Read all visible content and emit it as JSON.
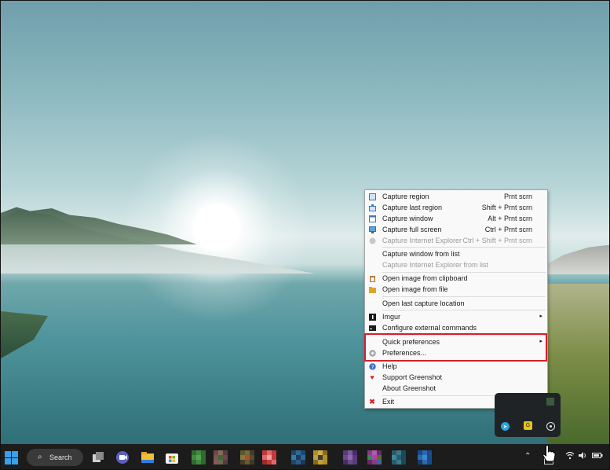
{
  "menu": {
    "items": [
      {
        "label": "Capture region",
        "shortcut": "Prnt scrn",
        "icon": "capture-region-icon",
        "disabled": false
      },
      {
        "label": "Capture last region",
        "shortcut": "Shift + Prnt scrn",
        "icon": "capture-last-region-icon",
        "disabled": false
      },
      {
        "label": "Capture window",
        "shortcut": "Alt + Prnt scrn",
        "icon": "capture-window-icon",
        "disabled": false
      },
      {
        "label": "Capture full screen",
        "shortcut": "Ctrl + Prnt scrn",
        "icon": "monitor-icon",
        "disabled": false
      },
      {
        "label": "Capture Internet Explorer",
        "shortcut": "Ctrl + Shift + Prnt scrn",
        "icon": "ie-icon",
        "disabled": true
      },
      {
        "label": "Capture window from list",
        "disabled": false
      },
      {
        "label": "Capture Internet Explorer from list",
        "disabled": true
      },
      {
        "label": "Open image from clipboard",
        "icon": "clipboard-icon",
        "disabled": false
      },
      {
        "label": "Open image from file",
        "icon": "open-file-icon",
        "disabled": false
      },
      {
        "label": "Open last capture location",
        "disabled": false
      },
      {
        "label": "Imgur",
        "icon": "imgur-icon",
        "submenu": true,
        "disabled": false
      },
      {
        "label": "Configure external commands",
        "icon": "terminal-icon",
        "disabled": false
      },
      {
        "label": "Quick preferences",
        "submenu": true,
        "disabled": false
      },
      {
        "label": "Preferences...",
        "icon": "gear-icon",
        "disabled": false
      },
      {
        "label": "Help",
        "icon": "help-icon",
        "disabled": false
      },
      {
        "label": "Support Greenshot",
        "icon": "heart-icon",
        "disabled": false
      },
      {
        "label": "About Greenshot",
        "disabled": false
      },
      {
        "label": "Exit",
        "icon": "close-icon",
        "disabled": false
      }
    ],
    "submenu_arrow": "▸"
  },
  "taskbar": {
    "search_label": "Search",
    "apps": [
      "start-icon",
      "task-view-icon",
      "teams-icon",
      "file-explorer-icon",
      "microsoft-store-icon"
    ],
    "tray": [
      "chevron-up-icon",
      "greenshot-tray-icon",
      "wifi-icon",
      "volume-icon",
      "battery-icon"
    ]
  },
  "tray_overflow": {
    "icons": [
      "telegram-icon",
      "greenshot-icon",
      "settings-tray-icon"
    ]
  },
  "colors": {
    "highlight": "#d6202c",
    "menu_bg": "#f9f9f9",
    "taskbar_bg": "#1c1c1c"
  }
}
